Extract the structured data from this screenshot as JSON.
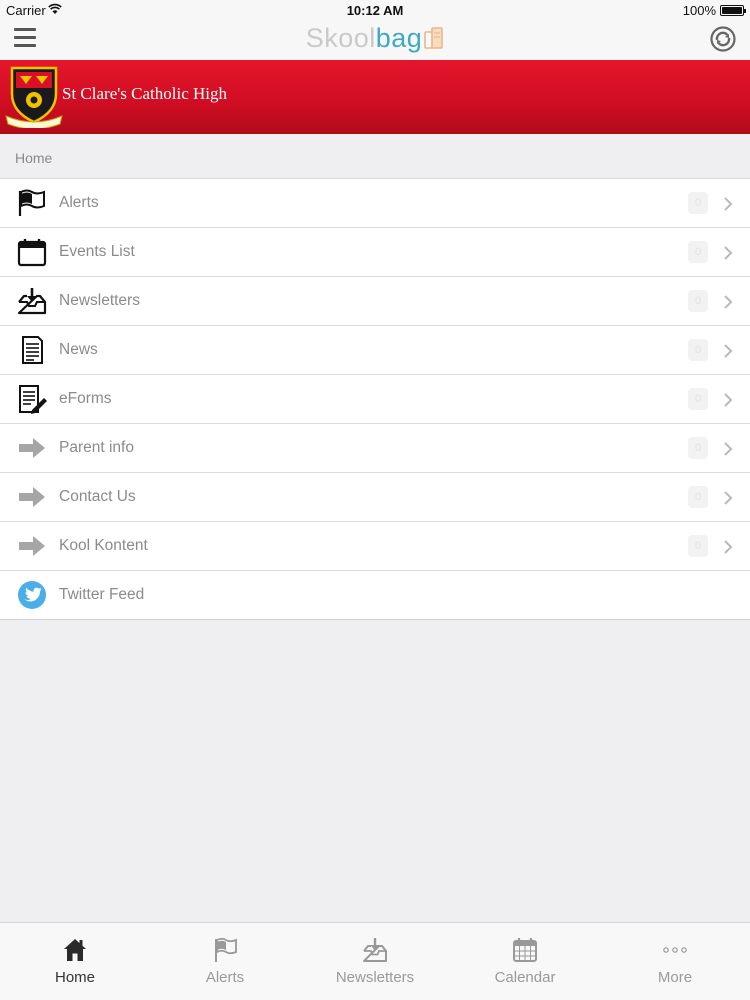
{
  "status_bar": {
    "carrier": "Carrier",
    "time": "10:12 AM",
    "battery": "100%"
  },
  "nav_bar": {
    "logo_part1": "Skool",
    "logo_part2": "bag"
  },
  "banner": {
    "school_name": "St Clare's Catholic High"
  },
  "breadcrumb": {
    "label": "Home"
  },
  "menu": {
    "items": [
      {
        "label": "Alerts",
        "icon": "flag-icon",
        "badge": "0"
      },
      {
        "label": "Events List",
        "icon": "calendar-icon",
        "badge": "0"
      },
      {
        "label": "Newsletters",
        "icon": "inbox-download-icon",
        "badge": "0"
      },
      {
        "label": "News",
        "icon": "document-icon",
        "badge": "0"
      },
      {
        "label": "eForms",
        "icon": "form-pen-icon",
        "badge": "0"
      },
      {
        "label": "Parent info",
        "icon": "arrow-right-icon",
        "badge": "0"
      },
      {
        "label": "Contact Us",
        "icon": "arrow-right-icon",
        "badge": "0"
      },
      {
        "label": "Kool Kontent",
        "icon": "arrow-right-icon",
        "badge": "0"
      },
      {
        "label": "Twitter Feed",
        "icon": "twitter-icon"
      }
    ]
  },
  "tab_bar": {
    "tabs": [
      {
        "label": "Home",
        "icon": "home-icon",
        "active": true
      },
      {
        "label": "Alerts",
        "icon": "flag-icon"
      },
      {
        "label": "Newsletters",
        "icon": "inbox-download-icon"
      },
      {
        "label": "Calendar",
        "icon": "calendar-grid-icon"
      },
      {
        "label": "More",
        "icon": "more-dots-icon"
      }
    ]
  },
  "colors": {
    "banner_red": "#d80f25",
    "accent_blue": "#3fa9c4",
    "twitter_blue": "#4aaee8"
  }
}
